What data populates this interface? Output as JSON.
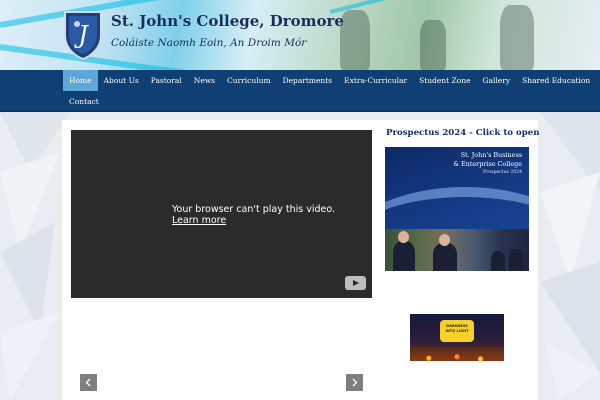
{
  "header": {
    "school_name": "St. John's College, Dromore",
    "school_subtitle": "Coláiste Naomh Eoin, An Droim Mór",
    "crest_icon": "crest-icon"
  },
  "nav": {
    "items": [
      {
        "label": "Home",
        "active": true
      },
      {
        "label": "About Us"
      },
      {
        "label": "Pastoral"
      },
      {
        "label": "News"
      },
      {
        "label": "Curriculum"
      },
      {
        "label": "Departments"
      },
      {
        "label": "Extra-Curricular"
      },
      {
        "label": "Student Zone"
      },
      {
        "label": "Gallery"
      },
      {
        "label": "Shared Education"
      },
      {
        "label": "Contact"
      }
    ]
  },
  "video": {
    "message": "Your browser can't play this video.",
    "link": "Learn more"
  },
  "prospectus": {
    "title": "Prospectus 2024 - Click to open",
    "image_line1": "St. John's Business",
    "image_line2": "& Enterprise College",
    "image_line3": "Prospectus 2024"
  },
  "promo_banner": {
    "text": "DARKNESS INTO LIGHT"
  },
  "slider": {
    "prev_icon": "chevron-left-icon",
    "next_icon": "chevron-right-icon"
  },
  "colors": {
    "nav_bg": "#0f3f73",
    "nav_active": "#5ea5d8",
    "title_blue": "#0f2f66"
  }
}
